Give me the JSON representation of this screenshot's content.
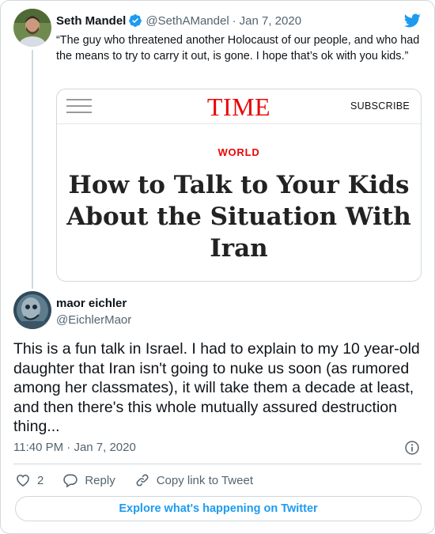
{
  "colors": {
    "accent": "#1d9bf0",
    "text": "#0f1419",
    "muted": "#536471",
    "border": "#cfd9de",
    "time_red": "#e90606"
  },
  "parent_tweet": {
    "name": "Seth Mandel",
    "handle": "@SethAMandel",
    "date": "Jan 7, 2020",
    "text": "“The guy who threatened another Holocaust of our people, and who had the means to try to carry it out, is gone. I hope that’s ok with you kids.”",
    "icons": {
      "verified": "verified-badge-icon",
      "brand": "twitter-bird-icon"
    },
    "link_card": {
      "logo": "TIME",
      "subscribe": "SUBSCRIBE",
      "section": "WORLD",
      "headline": "How to Talk to Your Kids About the Situation With Iran",
      "menu_icon": "hamburger-menu-icon"
    }
  },
  "tweet": {
    "name": "maor eichler",
    "handle": "@EichlerMaor",
    "text": "This is a fun talk in Israel. I had to explain to my 10 year-old daughter that Iran isn't going to nuke us soon (as rumored among her classmates), it will take them a decade at least, and then there's this whole mutually assured destruction thing...",
    "time": "11:40 PM",
    "date": "Jan 7, 2020",
    "info_icon": "info-icon"
  },
  "actions": {
    "like_count": "2",
    "reply_label": "Reply",
    "copy_link_label": "Copy link to Tweet",
    "icons": [
      "heart-icon",
      "reply-bubble-icon",
      "link-icon"
    ]
  },
  "footer": {
    "explore_label": "Explore what's happening on Twitter"
  }
}
